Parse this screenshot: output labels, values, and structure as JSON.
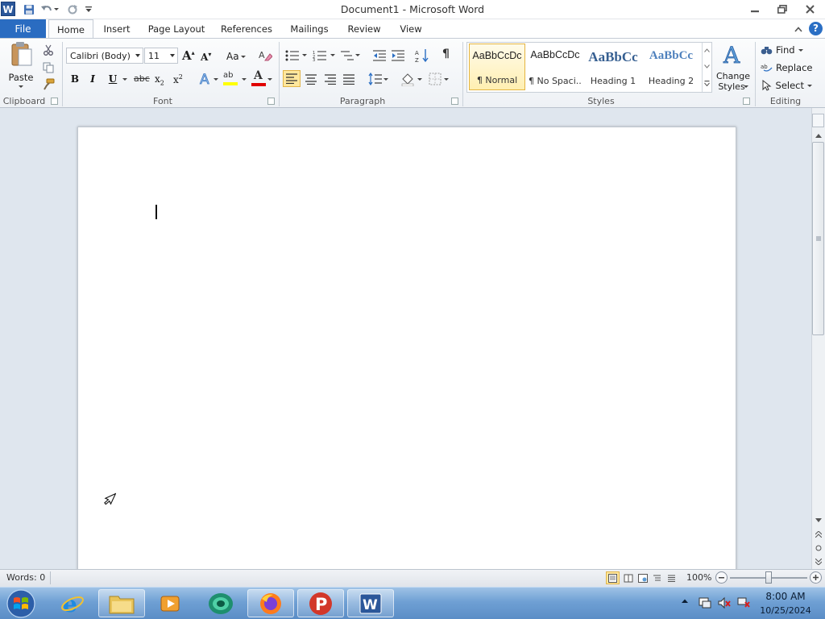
{
  "window": {
    "app_logo": "W",
    "title": "Document1  -  Microsoft Word",
    "quick_access": [
      "save-icon",
      "undo-icon",
      "redo-icon",
      "customize-icon"
    ],
    "controls": [
      "minimize-icon",
      "restore-icon",
      "close-icon"
    ]
  },
  "tabs": [
    "File",
    "Home",
    "Insert",
    "Page Layout",
    "References",
    "Mailings",
    "Review",
    "View"
  ],
  "active_tab": "Home",
  "clipboard": {
    "paste_label": "Paste",
    "group_label": "Clipboard"
  },
  "font": {
    "name": "Calibri (Body)",
    "size": "11",
    "grow": "A",
    "shrink": "A",
    "change_case": "Aa",
    "bold": "B",
    "italic": "I",
    "underline": "U",
    "strike": "abc",
    "subscript": "x",
    "superscript": "x",
    "highlight": "ab",
    "font_color": "A",
    "group_label": "Font"
  },
  "paragraph": {
    "show_marks": "¶",
    "group_label": "Paragraph"
  },
  "styles": {
    "items": [
      {
        "sample": "AaBbCcDc",
        "name": "¶ Normal"
      },
      {
        "sample": "AaBbCcDc",
        "name": "¶ No Spaci..."
      },
      {
        "sample": "AaBbCc",
        "name": "Heading 1"
      },
      {
        "sample": "AaBbCc",
        "name": "Heading 2"
      }
    ],
    "change_styles_line1": "Change",
    "change_styles_line2": "Styles",
    "group_label": "Styles"
  },
  "editing": {
    "find": "Find",
    "replace": "Replace",
    "select": "Select",
    "group_label": "Editing"
  },
  "status": {
    "words": "Words: 0",
    "zoom": "100%",
    "zoom_fraction": 0.5
  },
  "taskbar": {
    "apps": [
      "internet-explorer-icon",
      "file-explorer-icon",
      "media-player-icon",
      "green-app-icon",
      "firefox-icon",
      "p-app-icon",
      "word-icon"
    ],
    "time": "8:00 AM",
    "date": "10/25/2024"
  },
  "colors": {
    "file_tab": "#2a6cc1",
    "accent": "#2b579a",
    "selected_style": "#ffefb2"
  }
}
